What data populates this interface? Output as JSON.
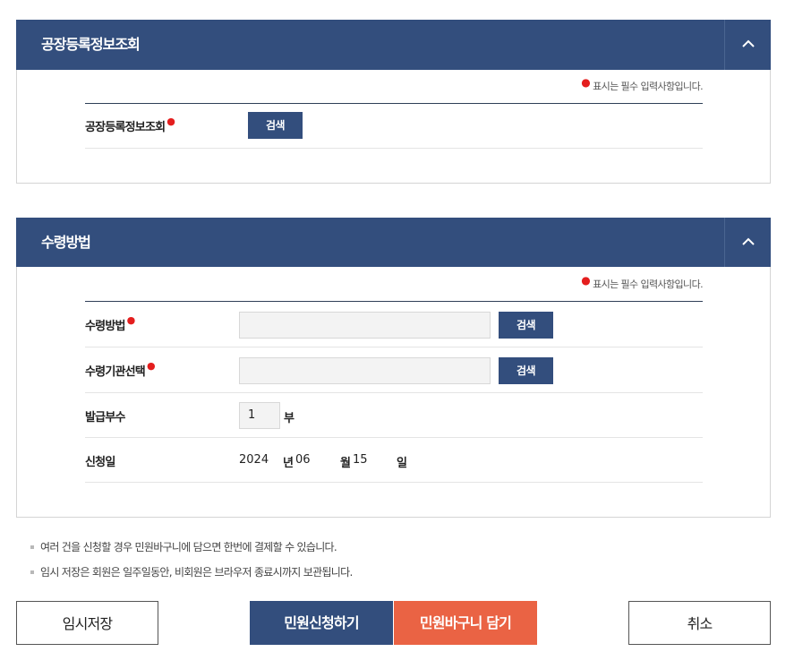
{
  "factory_section": {
    "title": "공장등록정보조회",
    "required_note": "표시는 필수 입력사항입니다.",
    "row_label": "공장등록정보조회",
    "search_label": "검색"
  },
  "receipt_section": {
    "title": "수령방법",
    "required_note": "표시는 필수 입력사항입니다.",
    "method_label": "수령방법",
    "method_value": "",
    "method_search": "검색",
    "agency_label": "수령기관선택",
    "agency_value": "",
    "agency_search": "검색",
    "copies_label": "발급부수",
    "copies_value": "1",
    "copies_unit": "부",
    "date_label": "신청일",
    "year": "2024",
    "year_unit": "년",
    "month": "06",
    "month_unit": "월",
    "day": "15",
    "day_unit": "일"
  },
  "notes": [
    "여러 건을 신청할 경우 민원바구니에 담으면 한번에 결제할 수 있습니다.",
    "임시 저장은 회원은 일주일동안, 비회원은 브라우저 종료시까지 보관됩니다."
  ],
  "buttons": {
    "temp_save": "임시저장",
    "apply": "민원신청하기",
    "add_basket": "민원바구니 담기",
    "cancel": "취소"
  },
  "icons": {
    "collapse": "chevron-up-icon",
    "note_bullet": "square-bullet-icon"
  },
  "colors": {
    "header": "#334e7d",
    "accent": "#ea6344",
    "required": "#e41e1e"
  }
}
